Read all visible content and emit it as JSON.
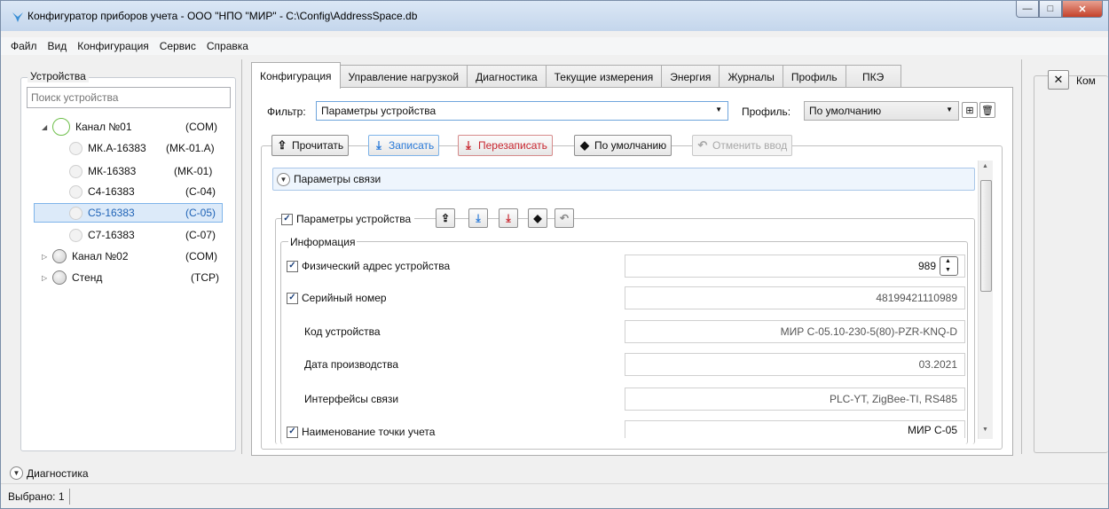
{
  "window": {
    "title": "Конфигуратор приборов учета - ООО \"НПО \"МИР\" - C:\\Config\\AddressSpace.db",
    "min_icon": "minimize-icon",
    "max_icon": "maximize-icon",
    "close_icon": "close-icon",
    "min_glyph": "—",
    "max_glyph": "□",
    "close_glyph": "✕"
  },
  "menu": [
    "Файл",
    "Вид",
    "Конфигурация",
    "Сервис",
    "Справка"
  ],
  "devices": {
    "legend": "Устройства",
    "search_placeholder": "Поиск устройства",
    "tree": [
      {
        "label": "Канал №01",
        "type": "(COM)",
        "expanded": true
      },
      {
        "label": "МК.А-16383",
        "type": "(MK-01.A)"
      },
      {
        "label": "МК-16383",
        "type": "(MK-01)"
      },
      {
        "label": "С4-16383",
        "type": "(C-04)"
      },
      {
        "label": "С5-16383",
        "type": "(C-05)",
        "selected": true
      },
      {
        "label": "С7-16383",
        "type": "(C-07)"
      },
      {
        "label": "Канал №02",
        "type": "(COM)"
      },
      {
        "label": "Стенд",
        "type": "(TCP)"
      }
    ]
  },
  "diagnostics": {
    "label": "Диагностика"
  },
  "status": {
    "selected": "Выбрано: 1"
  },
  "tabs": [
    "Конфигурация",
    "Управление нагрузкой",
    "Диагностика",
    "Текущие измерения",
    "Энергия",
    "Журналы",
    "Профиль",
    "ПКЭ"
  ],
  "filter": {
    "label": "Фильтр:",
    "value": "Параметры устройства"
  },
  "profile": {
    "label": "Профиль:",
    "value": "По умолчанию"
  },
  "toolbar": {
    "read": "Прочитать",
    "write": "Записать",
    "rewrite": "Перезаписать",
    "defaults": "По умолчанию",
    "cancel": "Отменить ввод"
  },
  "sections": {
    "comm": "Параметры связи",
    "device": "Параметры устройства",
    "info": "Информация"
  },
  "fields": [
    {
      "label": "Физический адрес устройства",
      "value": "989",
      "checkbox": true
    },
    {
      "label": "Серийный номер",
      "value": "48199421110989",
      "checkbox": true
    },
    {
      "label": "Код устройства",
      "value": "МИР С-05.10-230-5(80)-PZR-KNQ-D",
      "checkbox": false
    },
    {
      "label": "Дата производства",
      "value": "03.2021",
      "checkbox": false
    },
    {
      "label": "Интерфейсы связи",
      "value": "PLC-YT, ZigBee-TI, RS485",
      "checkbox": false
    },
    {
      "label": "Наименование точки учета",
      "value": "МИР С-05",
      "checkbox": true
    }
  ],
  "right_panel": {
    "label": "Ком",
    "close_glyph": "✕"
  },
  "colors": {
    "accent": "#2a7ad8",
    "danger": "#c8262f",
    "selection": "#dceaf9"
  }
}
